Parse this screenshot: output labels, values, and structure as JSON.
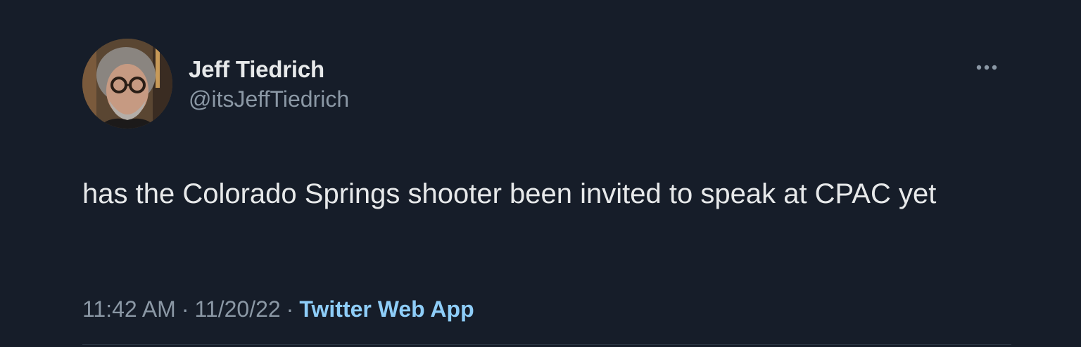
{
  "author": {
    "display_name": "Jeff Tiedrich",
    "handle": "@itsJeffTiedrich"
  },
  "tweet": {
    "text": "has the Colorado Springs shooter been invited to speak at CPAC yet",
    "time": "11:42 AM",
    "date": "11/20/22",
    "separator": "·",
    "source": "Twitter Web App"
  },
  "icons": {
    "more": "more-options-icon"
  },
  "colors": {
    "background": "#161d29",
    "primary_text": "#e7e9ea",
    "secondary_text": "#8b98a5",
    "source_link": "#8ecdf8"
  }
}
